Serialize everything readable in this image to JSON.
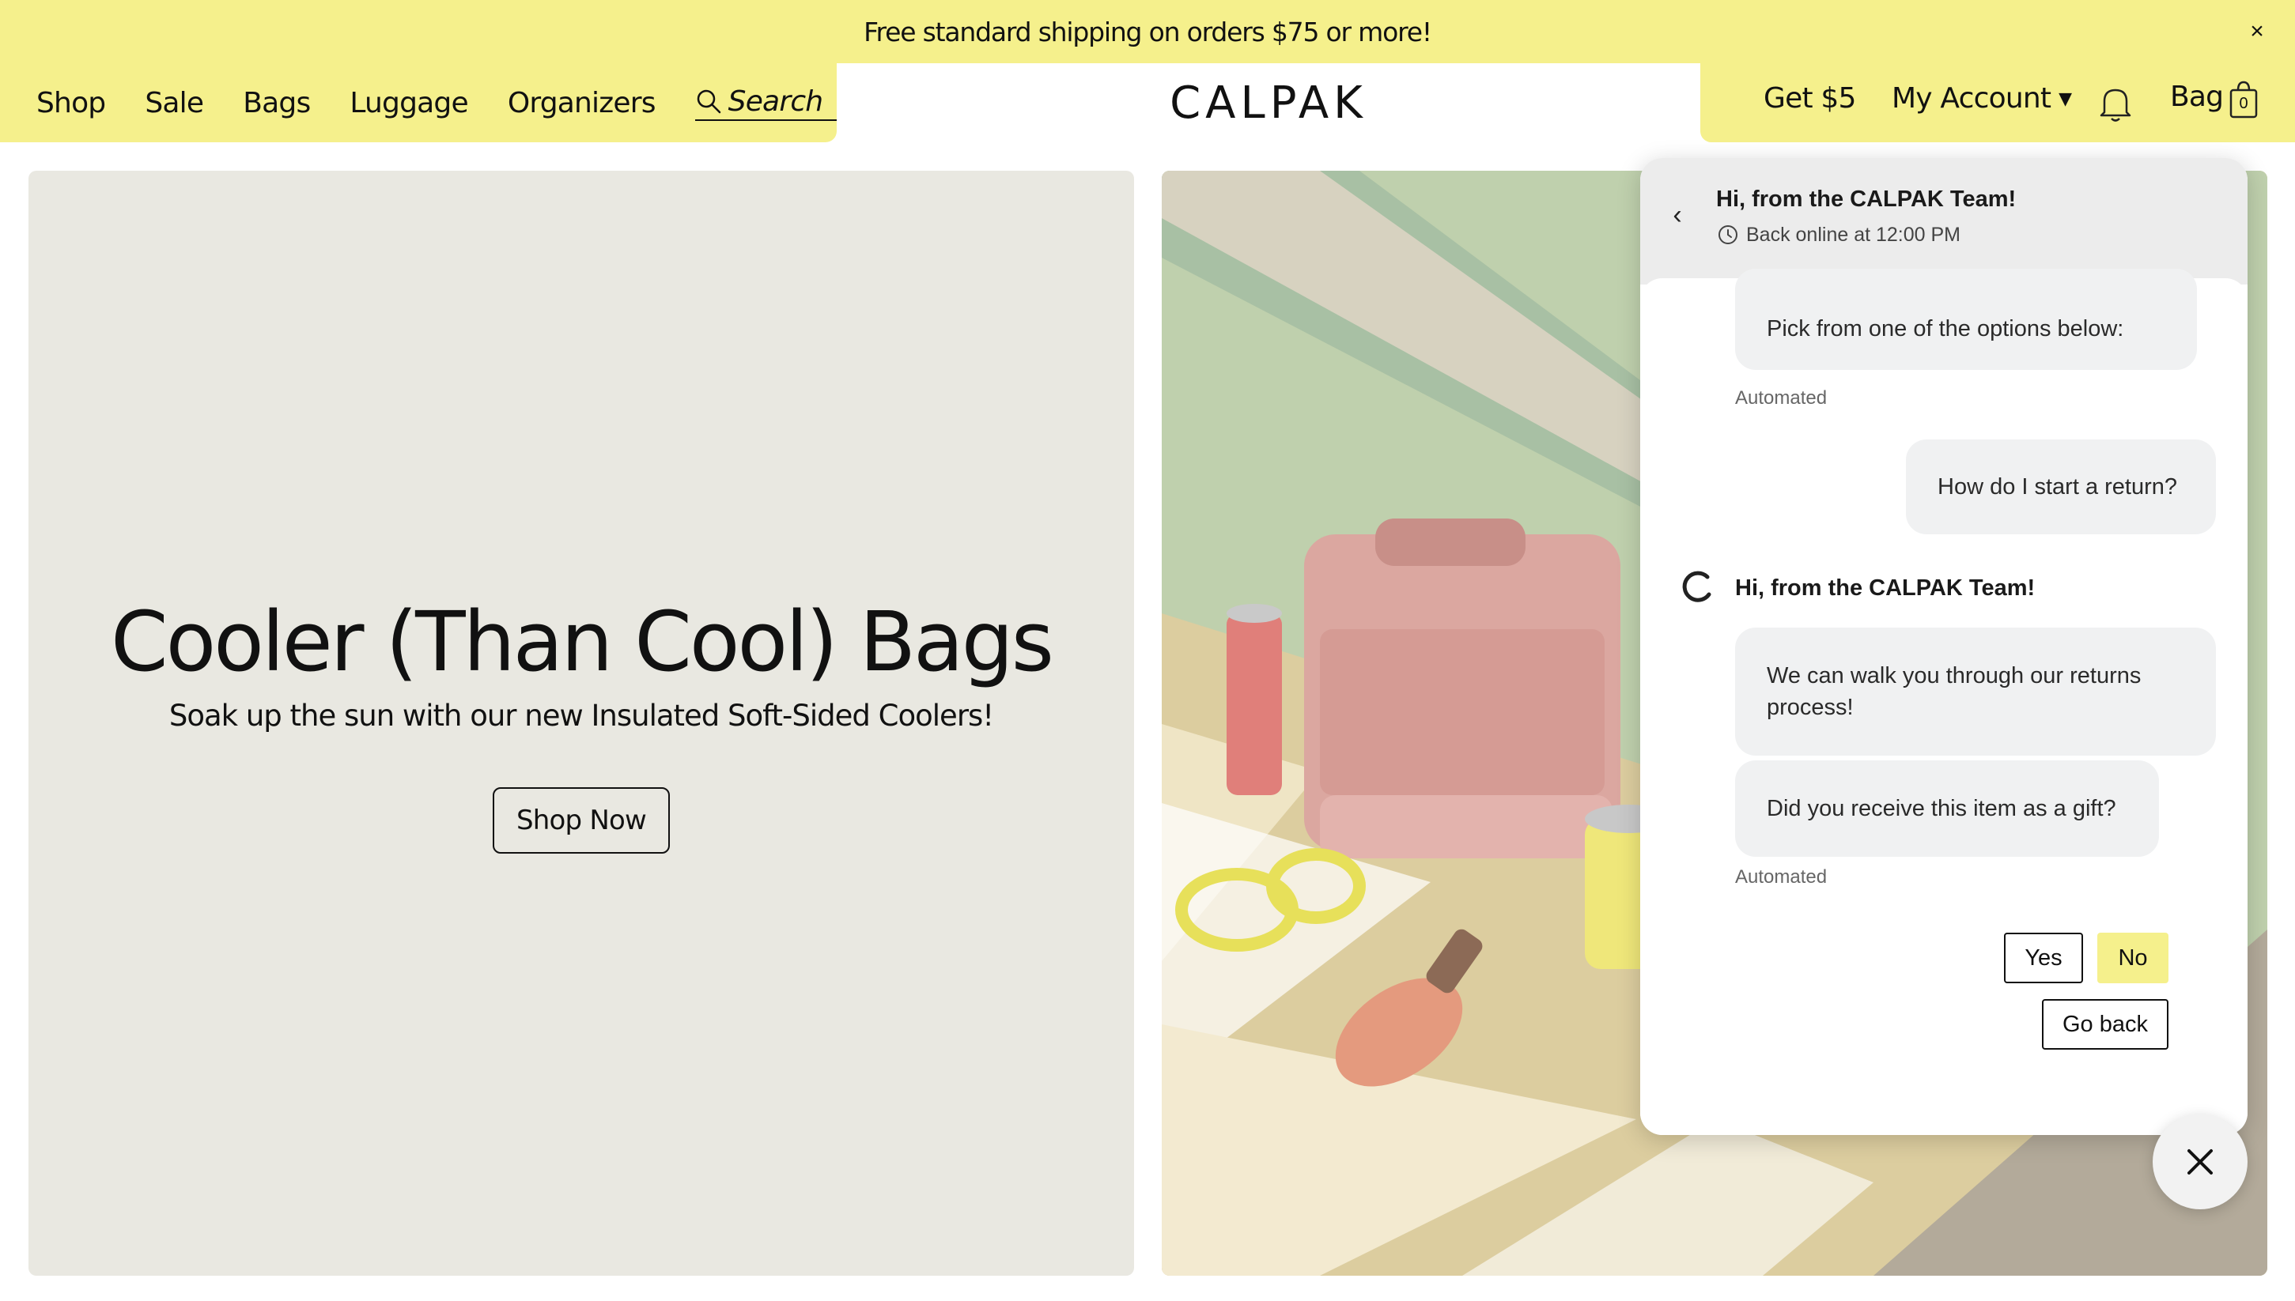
{
  "announcement": {
    "text": "Free standard shipping on orders $75 or more!",
    "close_icon": "close-icon"
  },
  "header": {
    "nav": [
      "Shop",
      "Sale",
      "Bags",
      "Luggage",
      "Organizers"
    ],
    "search_label": "Search",
    "logo": "CALPAK",
    "get5": "Get $5",
    "account": "My Account",
    "bag_label": "Bag",
    "bag_count": "0",
    "accent_color": "#f5f08c"
  },
  "hero": {
    "title": "Cooler (Than Cool) Bags",
    "subtitle": "Soak up the sun with our new Insulated Soft-Sided Coolers!",
    "cta": "Shop Now"
  },
  "chat": {
    "title": "Hi, from the CALPAK Team!",
    "status": "Back online at 12:00 PM",
    "messages": {
      "bot1": "Pick from one of the options below:",
      "automated1": "Automated",
      "user1": "How do I start a return?",
      "agent_name": "Hi, from the CALPAK Team!",
      "bot2": "We can walk you through our returns process!",
      "bot3": "Did you receive this item as a gift?",
      "automated2": "Automated"
    },
    "quick_replies": {
      "yes": "Yes",
      "no": "No",
      "go_back": "Go back"
    }
  }
}
